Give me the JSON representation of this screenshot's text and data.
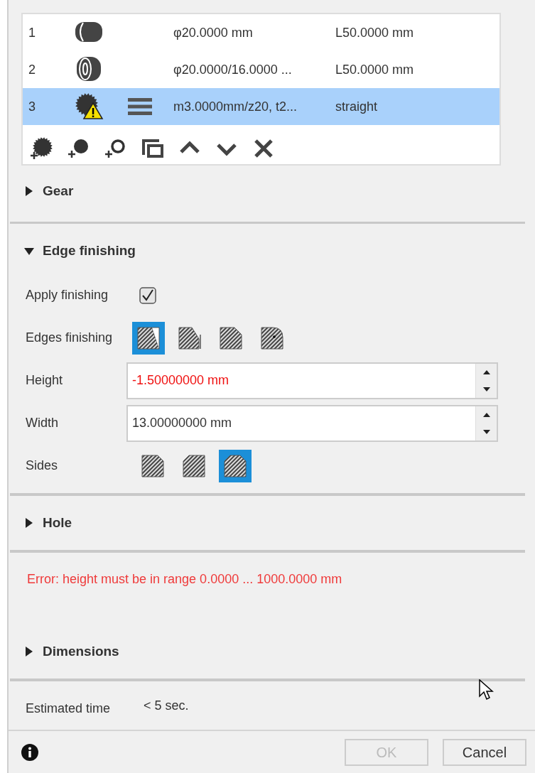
{
  "feature_list": {
    "rows": [
      {
        "number": "1",
        "kind": "cylinder",
        "warning": false,
        "profile": false,
        "column_3": "φ20.0000 mm",
        "column_4": "L50.0000 mm",
        "selected": false
      },
      {
        "number": "2",
        "kind": "tube",
        "warning": false,
        "profile": false,
        "column_3": "φ20.0000/16.0000 ...",
        "column_4": "L50.0000 mm",
        "selected": false
      },
      {
        "number": "3",
        "kind": "gear",
        "warning": true,
        "profile": true,
        "column_3": "m3.0000mm/z20, t2...",
        "column_4": "straight",
        "selected": true
      }
    ]
  },
  "gear_section": {
    "title": "Gear",
    "expanded": false
  },
  "edge_section": {
    "title": "Edge finishing",
    "expanded": true,
    "apply": {
      "label": "Apply finishing",
      "checked": true
    },
    "edges": {
      "label": "Edges finishing",
      "options": [
        {
          "kind": "chamfer",
          "selected": true
        },
        {
          "kind": "notch",
          "selected": false
        },
        {
          "kind": "corner",
          "selected": false
        },
        {
          "kind": "round",
          "selected": false
        }
      ]
    },
    "height": {
      "label": "Height",
      "value": "-1.50000000 mm",
      "invalid": true
    },
    "width": {
      "label": "Width",
      "value": "13.00000000 mm",
      "invalid": false
    },
    "sides": {
      "label": "Sides",
      "options": [
        {
          "kind": "right",
          "selected": false
        },
        {
          "kind": "left",
          "selected": false
        },
        {
          "kind": "both",
          "selected": true
        }
      ]
    }
  },
  "hole_section": {
    "title": "Hole",
    "expanded": false
  },
  "error_message": "Error: height must be in range 0.0000 ... 1000.0000 mm",
  "dimensions_section": {
    "title": "Dimensions",
    "expanded": false
  },
  "estimate": {
    "label": "Estimated time",
    "value": "< 5 sec."
  },
  "buttons": [
    {
      "label": "OK",
      "disabled": true
    },
    {
      "label": "Cancel",
      "disabled": false
    }
  ]
}
